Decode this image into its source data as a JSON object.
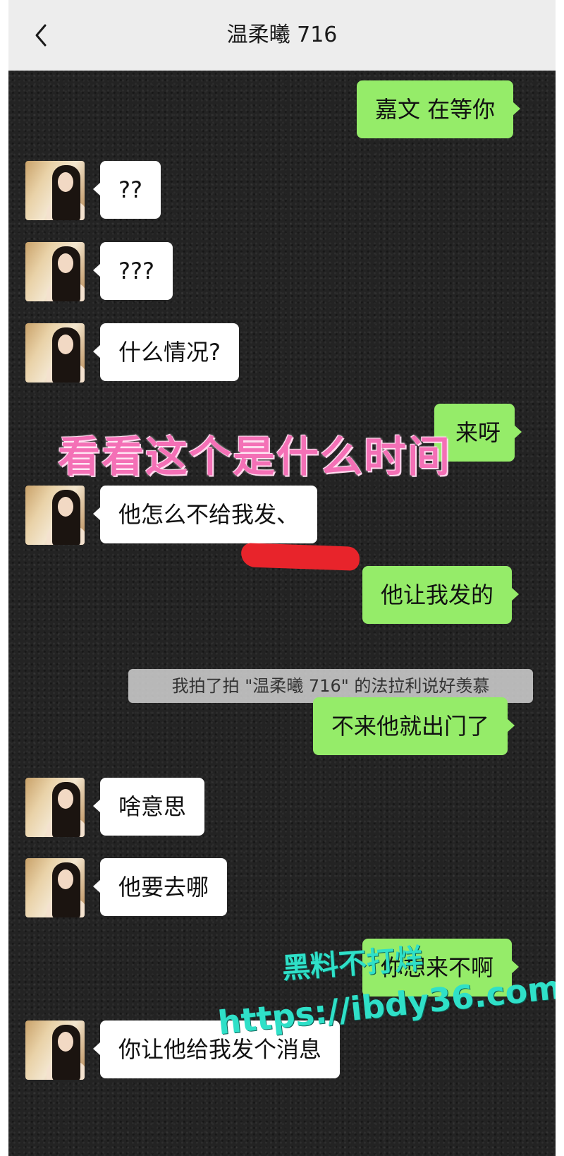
{
  "header": {
    "title": "温柔曦 716",
    "back_icon": "chevron-left-icon"
  },
  "messages": [
    {
      "side": "out",
      "text": "嘉文 在等你"
    },
    {
      "side": "in",
      "text": "??"
    },
    {
      "side": "in",
      "text": "???"
    },
    {
      "side": "in",
      "text": "什么情况?"
    },
    {
      "side": "out",
      "text": "来呀"
    },
    {
      "side": "in",
      "text": "他怎么不给我发、"
    },
    {
      "side": "out",
      "text": "他让我发的"
    },
    {
      "side": "out",
      "text": "不来他就出门了"
    },
    {
      "side": "in",
      "text": "啥意思"
    },
    {
      "side": "in",
      "text": "他要去哪"
    },
    {
      "side": "out",
      "text": "你想来不啊"
    },
    {
      "side": "in",
      "text": "你让他给我发个消息"
    }
  ],
  "system_message": "我拍了拍 \"温柔曦 716\" 的法拉利说好羡慕",
  "overlay_caption": "看看这个是什么时间",
  "watermark": {
    "line1": "黑料不打烊",
    "line2": "https://ibdy36.com"
  },
  "colors": {
    "outgoing_bubble": "#95ec69",
    "incoming_bubble": "#ffffff",
    "header_bg": "#ededed",
    "overlay_text": "#f470b6",
    "watermark": "#2fe0c8"
  }
}
